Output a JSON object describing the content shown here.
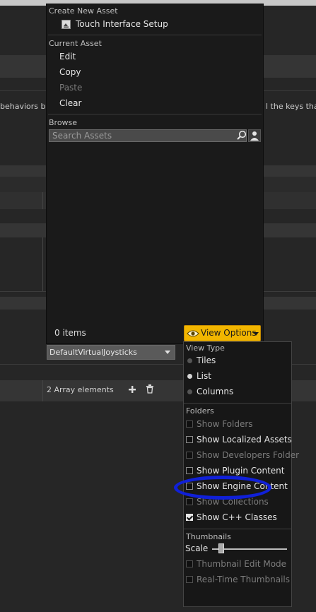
{
  "background": {
    "desc_left": "behaviors by",
    "desc_right": "l the keys that",
    "combo_value": "DefaultVirtualJoysticks",
    "array_text": "2 Array elements"
  },
  "asset_menu": {
    "create_header": "Create New Asset",
    "create_item": "Touch Interface Setup",
    "current_header": "Current Asset",
    "edit": "Edit",
    "copy": "Copy",
    "paste": "Paste",
    "clear": "Clear",
    "browse_header": "Browse",
    "search_placeholder": "Search Assets",
    "items_count": "0 items",
    "view_options": "View Options"
  },
  "view_options": {
    "view_type_header": "View Type",
    "view_types": [
      {
        "label": "Tiles",
        "selected": false
      },
      {
        "label": "List",
        "selected": true
      },
      {
        "label": "Columns",
        "selected": false
      }
    ],
    "folders_header": "Folders",
    "folder_options": [
      {
        "label": "Show Folders",
        "checked": false,
        "enabled": false
      },
      {
        "label": "Show Localized Assets",
        "checked": false,
        "enabled": true
      },
      {
        "label": "Show Developers Folder",
        "checked": false,
        "enabled": false
      },
      {
        "label": "Show Plugin Content",
        "checked": false,
        "enabled": true
      },
      {
        "label": "Show Engine Content",
        "checked": false,
        "enabled": true
      },
      {
        "label": "Show Collections",
        "checked": false,
        "enabled": false
      },
      {
        "label": "Show C++ Classes",
        "checked": true,
        "enabled": true
      }
    ],
    "thumbnails_header": "Thumbnails",
    "scale_label": "Scale",
    "scale_value": 0.12,
    "thumbnail_options": [
      {
        "label": "Thumbnail Edit Mode",
        "checked": false,
        "enabled": false
      },
      {
        "label": "Real-Time Thumbnails",
        "checked": false,
        "enabled": false
      }
    ]
  },
  "colors": {
    "accent": "#f2b600",
    "highlight_ring": "#1020d8"
  }
}
